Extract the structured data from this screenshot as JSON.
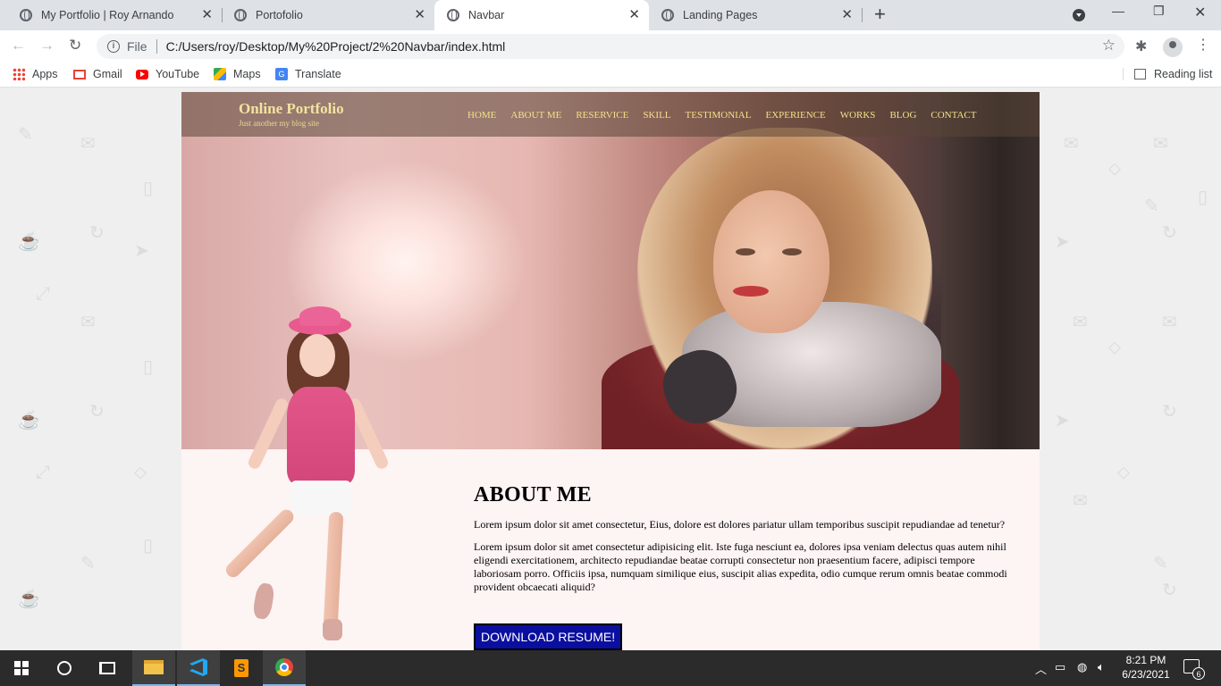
{
  "browser": {
    "tabs": [
      {
        "label": "My Portfolio | Roy Arnando",
        "active": false
      },
      {
        "label": "Portofolio",
        "active": false
      },
      {
        "label": "Navbar",
        "active": true
      },
      {
        "label": "Landing Pages",
        "active": false
      }
    ],
    "address": {
      "scheme": "File",
      "url": "C:/Users/roy/Desktop/My%20Project/2%20Navbar/index.html"
    },
    "bookmarks": [
      "Apps",
      "Gmail",
      "YouTube",
      "Maps",
      "Translate"
    ],
    "reading_list": "Reading list"
  },
  "site": {
    "brand": "Online Portfolio",
    "tagline": "Just another my blog site",
    "nav": [
      "HOME",
      "ABOUT ME",
      "RESERVICE",
      "SKILL",
      "TESTIMONIAL",
      "EXPERIENCE",
      "WORKS",
      "BLOG",
      "CONTACT"
    ],
    "about": {
      "heading": "ABOUT ME",
      "p1": "Lorem ipsum dolor sit amet consectetur, Eius, dolore est dolores pariatur ullam temporibus suscipit repudiandae ad tenetur?",
      "p2": "Lorem ipsum dolor sit amet consectetur adipisicing elit. Iste fuga nesciunt ea, dolores ipsa veniam delectus quas autem nihil eligendi exercitationem, architecto repudiandae beatae corrupti consectetur non praesentium facere, adipisci tempore laboriosam porro. Officiis ipsa, numquam similique eius, suscipit alias expedita, odio cumque rerum omnis beatae commodi provident obcaecati aliquid?",
      "button": "DOWNLOAD RESUME!"
    }
  },
  "taskbar": {
    "time": "8:21 PM",
    "date": "6/23/2021",
    "notifications": "6"
  },
  "colors": {
    "nav_link": "#f2e08a",
    "button_bg": "#0b0fa0",
    "about_bg": "#fdf4f4"
  }
}
